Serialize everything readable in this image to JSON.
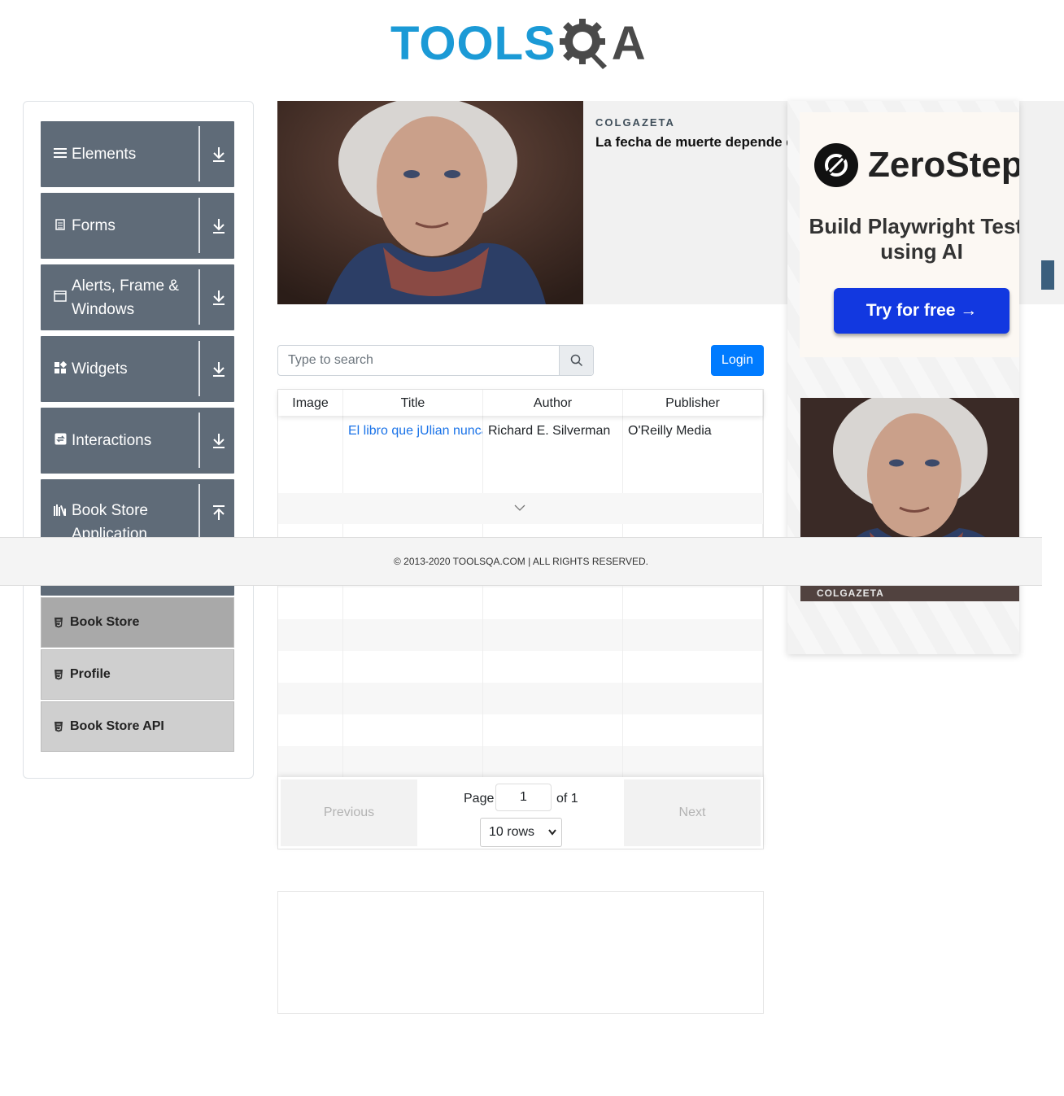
{
  "header": {
    "logo_left": "TOOLS",
    "logo_right": "A"
  },
  "sidebar": {
    "groups": [
      {
        "label": "Elements",
        "icon": "hamburger-icon"
      },
      {
        "label": "Forms",
        "icon": "document-icon"
      },
      {
        "label": "Alerts, Frame & Windows",
        "icon": "window-icon"
      },
      {
        "label": "Widgets",
        "icon": "widgets-icon"
      },
      {
        "label": "Interactions",
        "icon": "interactions-icon"
      },
      {
        "label": "Book Store Application",
        "icon": "books-icon"
      }
    ],
    "items": [
      {
        "label": "Book Store"
      },
      {
        "label": "Profile"
      },
      {
        "label": "Book Store API"
      }
    ]
  },
  "ad_top": {
    "brand": "COLGAZETA",
    "headline": "La fecha de muerte depende de números"
  },
  "search": {
    "placeholder": "Type to search"
  },
  "login": {
    "label": "Login"
  },
  "table": {
    "columns": [
      "Image",
      "Title",
      "Author",
      "Publisher"
    ],
    "rows": [
      {
        "title": "El libro que jUlian nunca",
        "author": "Richard E. Silverman",
        "publisher": "O'Reilly Media"
      }
    ]
  },
  "pagination": {
    "previous": "Previous",
    "next": "Next",
    "page_label": "Page",
    "page_value": "1",
    "of_label": "of 1",
    "rows_option": "10 rows"
  },
  "ad_right": {
    "brand": "ZeroStep",
    "subtitle": "Build Playwright Tests using AI",
    "cta": "Try for free →",
    "caption": "COLGAZETA"
  },
  "footer": {
    "text": "© 2013-2020 TOOLSQA.COM | ALL RIGHTS RESERVED."
  },
  "colors": {
    "brand_blue": "#1b9ad6",
    "primary": "#007bff",
    "sidebar_group": "#5f6b78",
    "zs_button": "#1238e0"
  }
}
